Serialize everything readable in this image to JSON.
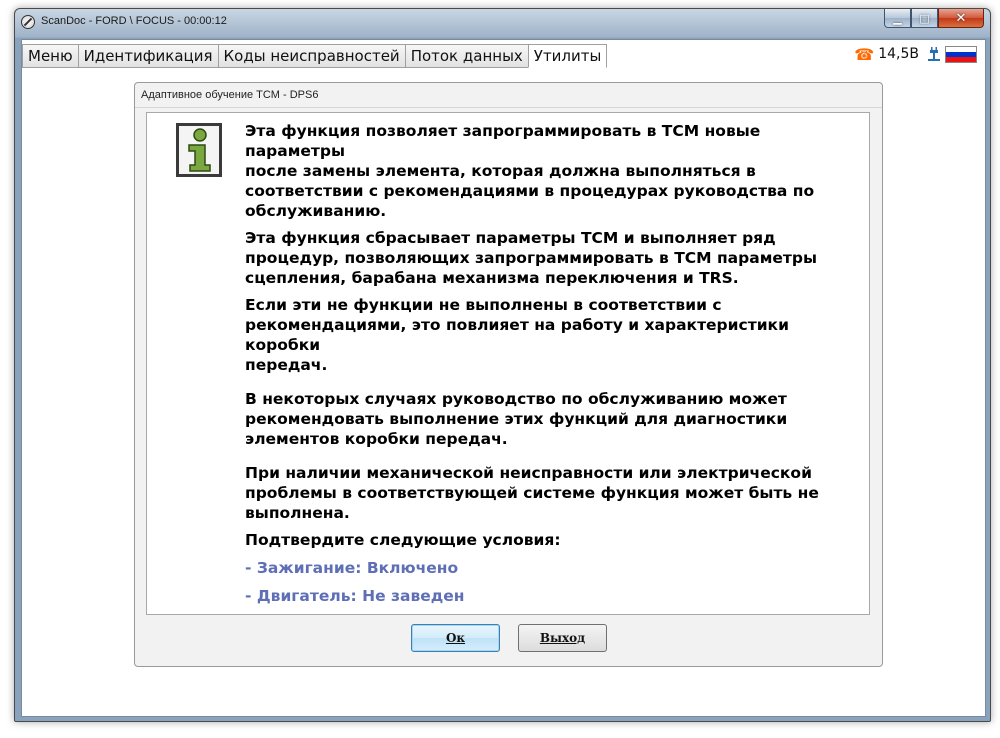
{
  "window": {
    "title": "ScanDoc - FORD \\ FOCUS - 00:00:12",
    "controls": {
      "minimize": "▁",
      "maximize": "□",
      "close": "✕"
    }
  },
  "tabs": [
    {
      "label": "Меню",
      "active": false
    },
    {
      "label": "Идентификация",
      "active": false
    },
    {
      "label": "Коды неисправностей",
      "active": false
    },
    {
      "label": "Поток данных",
      "active": false
    },
    {
      "label": "Утилиты",
      "active": true
    }
  ],
  "status": {
    "phone_icon": "phone-icon",
    "voltage": "14,5В",
    "plug_icon": "plug-icon",
    "flag_colors": [
      "#ffffff",
      "#0033cc",
      "#ee1111"
    ]
  },
  "dialog": {
    "title": "Адаптивное обучение TCM - DPS6",
    "paragraphs": [
      "Эта функция позволяет запрограммировать в TCM новые параметры\nпосле замены элемента, которая должна выполняться в\nсоответствии с рекомендациями в процедурах руководства по\nобслуживанию.",
      "Эта функция сбрасывает параметры TCM и выполняет ряд\nпроцедур, позволяющих запрограммировать в TCM параметры\nсцепления, барабана механизма переключения и TRS.",
      "Если эти не функции не выполнены в соответствии с\nрекомендациями, это повлияет на работу и характеристики коробки\nпередач.",
      "В некоторых случаях руководство по обслуживанию может\nрекомендовать выполнение этих функций для диагностики\nэлементов коробки передач.",
      "При наличии механической неисправности или электрической\nпроблемы в соответствующей системе функция может быть не\nвыполнена.",
      "Подтвердите следующие условия:"
    ],
    "conditions": [
      "- Зажигание: Включено",
      "- Двигатель: Не заведен"
    ],
    "condition_color": "#5e6fb5",
    "ok_label": "Ок",
    "exit_label": "Выход"
  }
}
